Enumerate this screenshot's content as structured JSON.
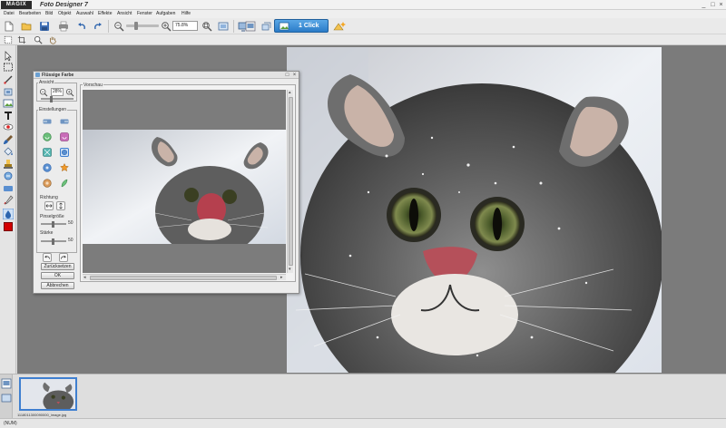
{
  "app": {
    "logo": "MAGIX",
    "title": "Foto Designer 7"
  },
  "window_controls": [
    "_",
    "□",
    "×"
  ],
  "menu": [
    "Datei",
    "Bearbeiten",
    "Bild",
    "Objekt",
    "Auswahl",
    "Effekte",
    "Ansicht",
    "Fenster",
    "Aufgaben",
    "Hilfe"
  ],
  "toolbar": {
    "zoom_value": "75.8%",
    "one_click_label": "1 Click"
  },
  "dialog": {
    "title": "Flüssige Farbe",
    "ansicht_label": "Ansicht",
    "zoom_value": "28%",
    "einstellungen_label": "Einstellungen",
    "richtung_label": "Richtung",
    "pinselgroesse_label": "Pinselgröße",
    "pinselgroesse_value": "50",
    "staerke_label": "Stärke",
    "staerke_value": "50",
    "reset_label": "Zurücksetzen",
    "ok_label": "OK",
    "cancel_label": "Abbrechen",
    "preview_label": "Vorschau"
  },
  "media_pool": {
    "thumbnail_label": "1118011300090000_image.jpg"
  },
  "status": {
    "text": "(NUM)"
  },
  "colors": {
    "accent": "#2b7cc8",
    "active_color_swatch": "#d40000"
  }
}
